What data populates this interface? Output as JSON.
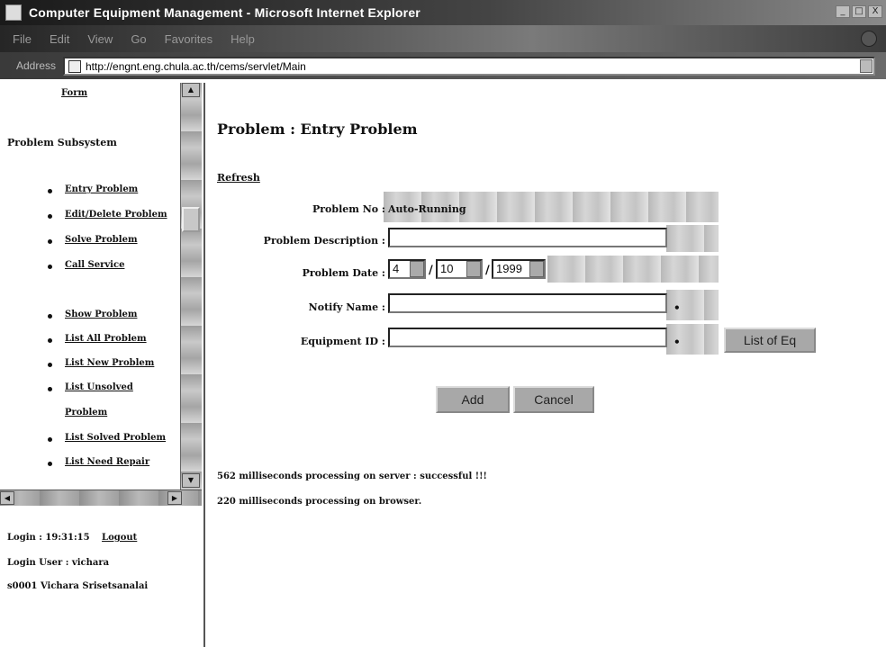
{
  "window": {
    "title": "Computer Equipment Management - Microsoft Internet Explorer",
    "controls": [
      "_",
      "□",
      "X"
    ]
  },
  "menubar": {
    "items": [
      "File",
      "Edit",
      "View",
      "Go",
      "Favorites",
      "Help"
    ]
  },
  "address": {
    "label": "Address",
    "url": "http://engnt.eng.chula.ac.th/cems/servlet/Main"
  },
  "sidebar": {
    "top_link": "Form",
    "section_title": "Problem Subsystem",
    "items": [
      {
        "label": "Entry Problem"
      },
      {
        "label": "Edit/Delete Problem"
      },
      {
        "label": "Solve Problem"
      },
      {
        "label": "Call Service"
      },
      {
        "label": "Show Problem"
      },
      {
        "label": "List All Problem"
      },
      {
        "label": "List New Problem"
      },
      {
        "label": "List Unsolved"
      },
      {
        "label": "Problem"
      },
      {
        "label": "List Solved Problem"
      },
      {
        "label": "List Need Repair"
      }
    ],
    "login": {
      "time_text": "Login : 19:31:15",
      "logout_label": "Logout",
      "user_text": "Login User : vichara",
      "id_text": "s0001   Vichara Srisetsanalai"
    }
  },
  "main": {
    "page_title": "Problem : Entry Problem",
    "refresh_label": "Refresh",
    "form": {
      "problem_no_label": "Problem No :",
      "problem_no_value": "Auto-Running",
      "description_label": "Problem Description :",
      "description_value": "",
      "date_label": "Problem Date :",
      "date_day": "4",
      "date_month": "10",
      "date_year": "1999",
      "date_sep": "/",
      "notify_label": "Notify Name :",
      "notify_value": "",
      "equipment_label": "Equipment ID :",
      "equipment_value": "",
      "required_mark": "•",
      "list_button": "List of Eq",
      "add_button": "Add",
      "cancel_button": "Cancel"
    },
    "server_msg": "562 milliseconds processing on server : successful !!!",
    "browser_msg": "220 milliseconds processing on browser."
  }
}
